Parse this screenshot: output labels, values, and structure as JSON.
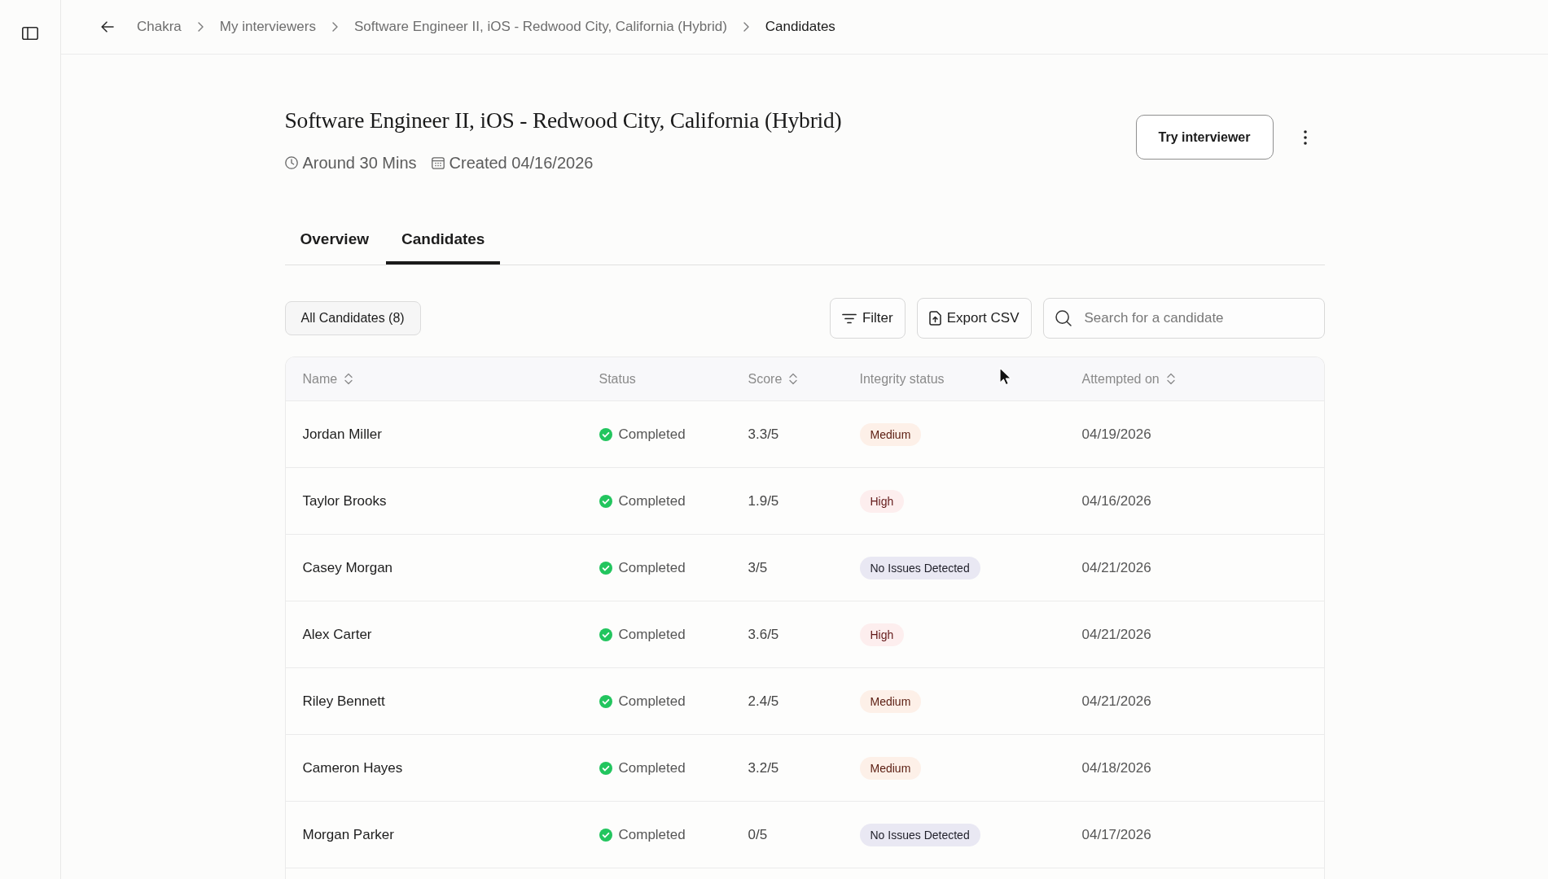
{
  "breadcrumb": [
    {
      "label": "Chakra",
      "current": false
    },
    {
      "label": "My interviewers",
      "current": false
    },
    {
      "label": "Software Engineer II, iOS - Redwood City, California (Hybrid)",
      "current": false
    },
    {
      "label": "Candidates",
      "current": true
    }
  ],
  "header": {
    "title": "Software Engineer II, iOS - Redwood City, California (Hybrid)",
    "meta": [
      {
        "kind": "duration",
        "text": "Around 30 Mins"
      },
      {
        "kind": "created",
        "text": "Created 04/16/2026"
      }
    ],
    "button": "Try interviewer"
  },
  "tabs": [
    {
      "label": "Overview",
      "selected": false
    },
    {
      "label": "Candidates",
      "selected": true
    }
  ],
  "toolbar": {
    "segment": "All Candidates (8)",
    "buttons": [
      {
        "kind": "filter",
        "label": "Filter"
      },
      {
        "kind": "export",
        "label": "Export CSV"
      }
    ],
    "search": {
      "placeholder": "Search for a candidate"
    }
  },
  "table": {
    "columns": [
      {
        "label": "Name",
        "sortable": true
      },
      {
        "label": "Status",
        "sortable": false
      },
      {
        "label": "Score",
        "sortable": true
      },
      {
        "label": "Integrity status",
        "sortable": false
      },
      {
        "label": "Attempted on",
        "sortable": true
      }
    ],
    "rows": [
      {
        "name": "Jordan Miller",
        "status": "Completed",
        "score": "3.3/5",
        "integrity": {
          "label": "Medium",
          "kind": "medium"
        },
        "attempted_on": "04/19/2026"
      },
      {
        "name": "Taylor Brooks",
        "status": "Completed",
        "score": "1.9/5",
        "integrity": {
          "label": "High",
          "kind": "high"
        },
        "attempted_on": "04/16/2026"
      },
      {
        "name": "Casey Morgan",
        "status": "Completed",
        "score": "3/5",
        "integrity": {
          "label": "No Issues Detected",
          "kind": "none"
        },
        "attempted_on": "04/21/2026"
      },
      {
        "name": "Alex Carter",
        "status": "Completed",
        "score": "3.6/5",
        "integrity": {
          "label": "High",
          "kind": "high"
        },
        "attempted_on": "04/21/2026"
      },
      {
        "name": "Riley Bennett",
        "status": "Completed",
        "score": "2.4/5",
        "integrity": {
          "label": "Medium",
          "kind": "medium"
        },
        "attempted_on": "04/21/2026"
      },
      {
        "name": "Cameron Hayes",
        "status": "Completed",
        "score": "3.2/5",
        "integrity": {
          "label": "Medium",
          "kind": "medium"
        },
        "attempted_on": "04/18/2026"
      },
      {
        "name": "Morgan Parker",
        "status": "Completed",
        "score": "0/5",
        "integrity": {
          "label": "No Issues Detected",
          "kind": "none"
        },
        "attempted_on": "04/17/2026"
      }
    ]
  }
}
